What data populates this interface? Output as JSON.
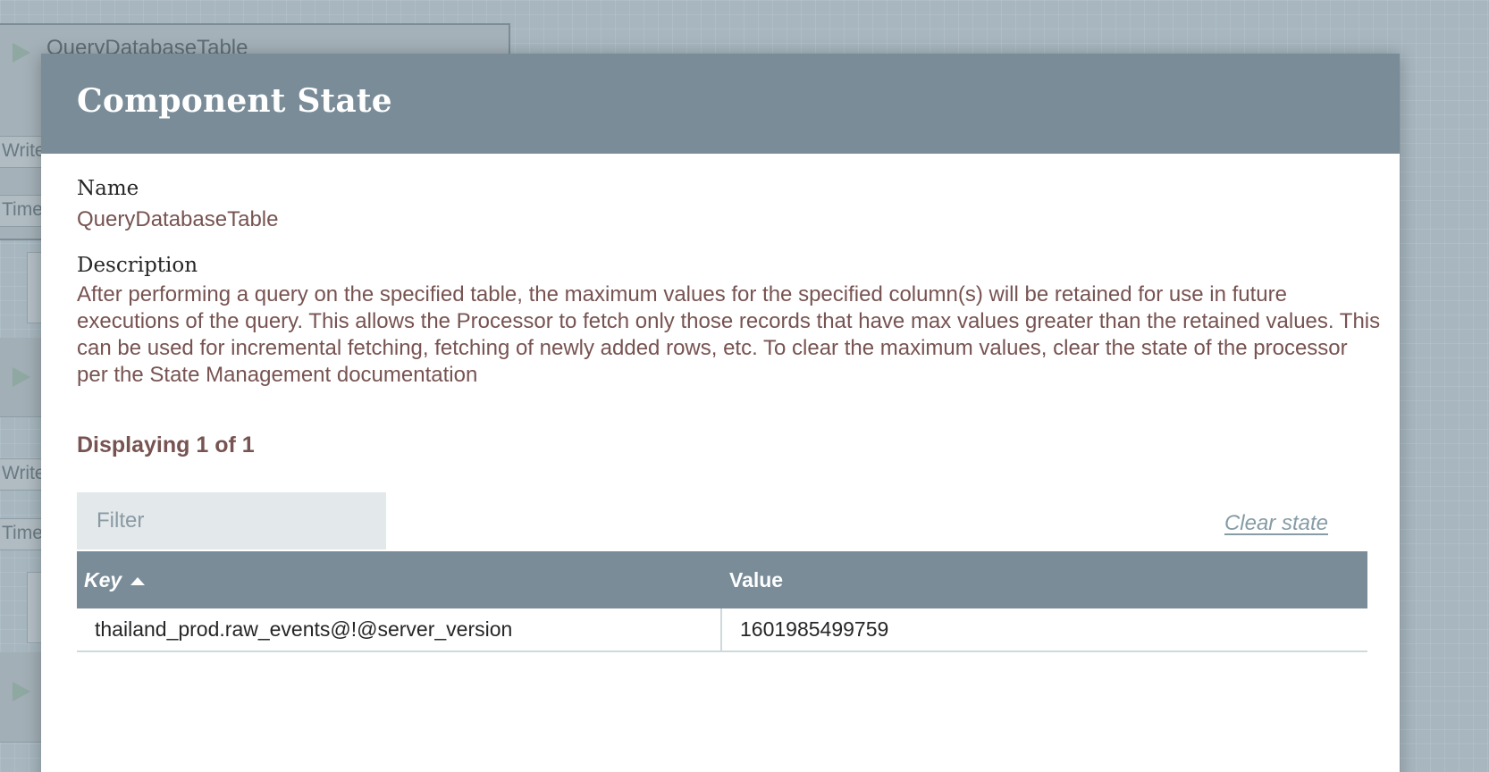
{
  "background": {
    "processor_title": "QueryDatabaseTable",
    "row_labels": [
      "Write",
      "Time",
      "Write",
      "Time"
    ]
  },
  "dialog": {
    "title": "Component State",
    "name_label": "Name",
    "name_value": "QueryDatabaseTable",
    "description_label": "Description",
    "description_value": "After performing a query on the specified table, the maximum values for the specified column(s) will be retained for use in future executions of the query. This allows the Processor to fetch only those records that have max values greater than the retained values. This can be used for incremental fetching, fetching of newly added rows, etc. To clear the maximum values, clear the state of the processor per the State Management documentation",
    "count_text": "Displaying 1 of 1",
    "filter_placeholder": "Filter",
    "clear_state_label": "Clear state"
  },
  "table": {
    "columns": [
      {
        "label": "Key",
        "sorted": "ascending"
      },
      {
        "label": "Value"
      }
    ],
    "rows": [
      {
        "key": "thailand_prod.raw_events@!@server_version",
        "value": "1601985499759"
      }
    ]
  },
  "colors": {
    "header_bg": "#798c98",
    "accent_text": "#775351",
    "link": "#869ca6",
    "filter_bg": "#e3e8eb"
  },
  "icons": {
    "run": "play-icon",
    "sort": "sort-ascending-icon"
  }
}
